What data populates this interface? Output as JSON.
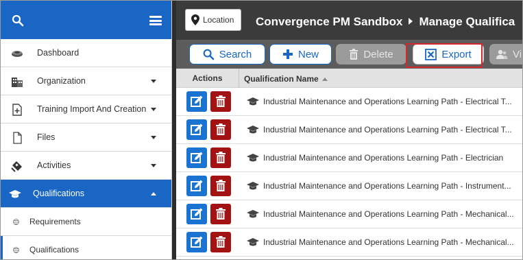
{
  "sidebar": {
    "items": [
      {
        "label": "Dashboard",
        "icon": "dashboard-icon",
        "expandable": false
      },
      {
        "label": "Organization",
        "icon": "organization-icon",
        "expandable": true
      },
      {
        "label": "Training Import And Creation",
        "icon": "training-import-icon",
        "expandable": true
      },
      {
        "label": "Files",
        "icon": "file-icon",
        "expandable": true
      },
      {
        "label": "Activities",
        "icon": "activities-icon",
        "expandable": true
      },
      {
        "label": "Qualifications",
        "icon": "graduation-cap-icon",
        "expandable": true,
        "active": true
      }
    ],
    "subitems": [
      {
        "label": "Requirements"
      },
      {
        "label": "Qualifications"
      }
    ]
  },
  "header": {
    "location_label": "Location",
    "breadcrumb": [
      "Convergence PM Sandbox",
      "Manage Qualifica"
    ]
  },
  "toolbar": {
    "search_label": "Search",
    "new_label": "New",
    "delete_label": "Delete",
    "export_label": "Export",
    "view_label": "Vi"
  },
  "grid": {
    "columns": [
      "Actions",
      "Qualification Name"
    ],
    "rows": [
      "Industrial Maintenance and Operations Learning Path - Electrical T...",
      "Industrial Maintenance and Operations Learning Path - Electrical T...",
      "Industrial Maintenance and Operations Learning Path - Electrician",
      "Industrial Maintenance and Operations Learning Path - Instrument...",
      "Industrial Maintenance and Operations Learning Path - Mechanical...",
      "Industrial Maintenance and Operations Learning Path - Mechanical..."
    ]
  },
  "colors": {
    "brand_blue": "#1a66c4",
    "delete_red": "#a31313",
    "highlight_red": "#d9262e"
  }
}
